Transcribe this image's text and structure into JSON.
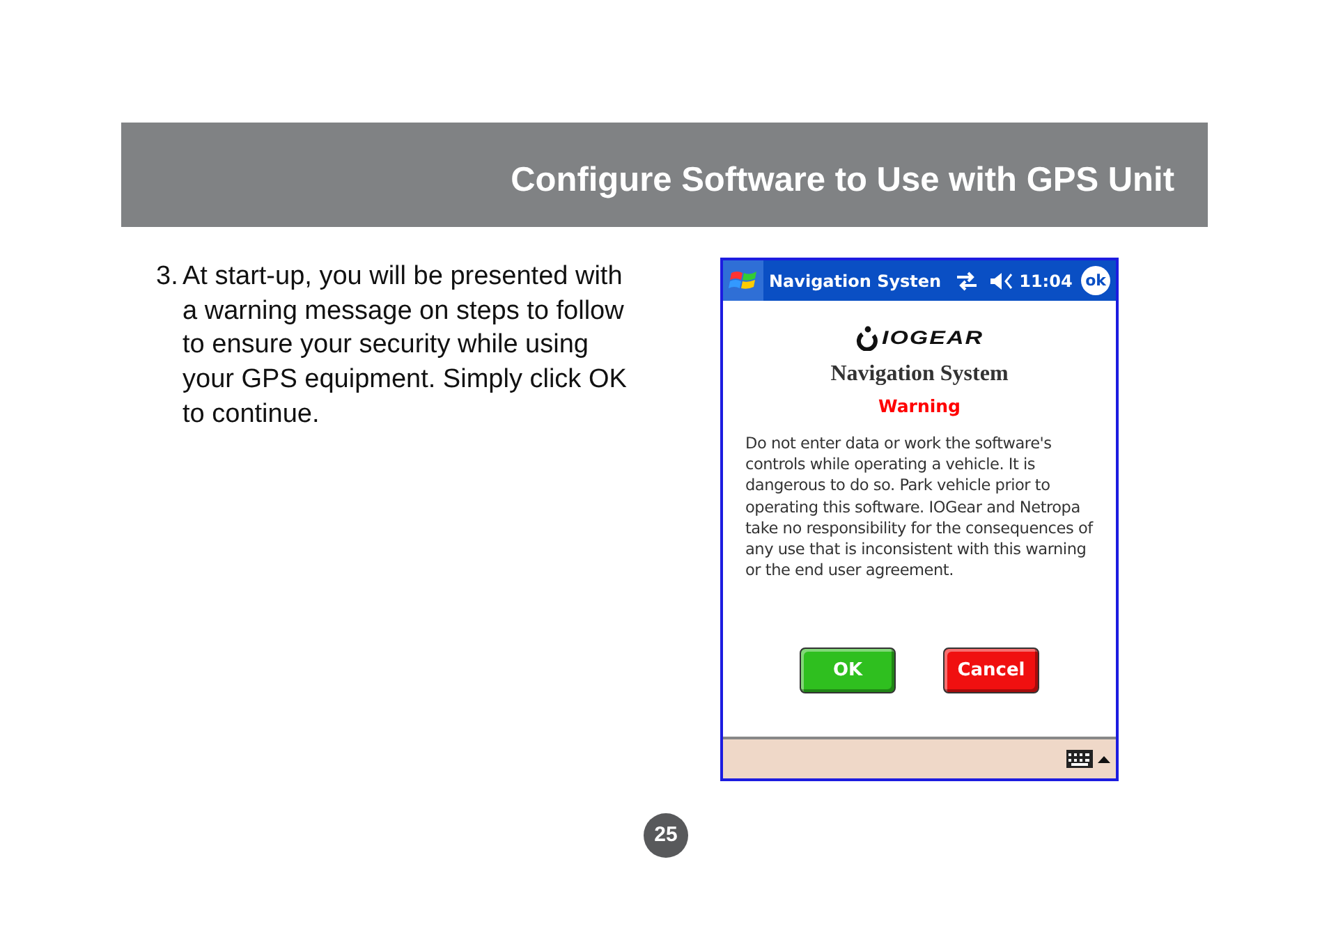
{
  "header": {
    "title": "Configure Software to Use with GPS Unit"
  },
  "step": {
    "number": "3.",
    "text": "At start-up, you will be presented with a warning message on steps to follow to ensure your security while using your GPS equipment.  Simply click OK to continue."
  },
  "device": {
    "taskbar": {
      "title": "Navigation Systen",
      "time": "11:04",
      "ok": "ok"
    },
    "logo": "IOGEAR",
    "app_title": "Navigation System",
    "warning": "Warning",
    "message": "Do not enter data or work the software's controls while operating a vehicle.  It is dangerous to do so.  Park vehicle prior to operating this software.  IOGear and Netropa take no responsibility for the consequences of any use that is inconsistent with this warning or the end user agreement.",
    "buttons": [
      {
        "label": "OK",
        "kind": "ok"
      },
      {
        "label": "Cancel",
        "kind": "cancel"
      }
    ]
  },
  "page_number": "25"
}
